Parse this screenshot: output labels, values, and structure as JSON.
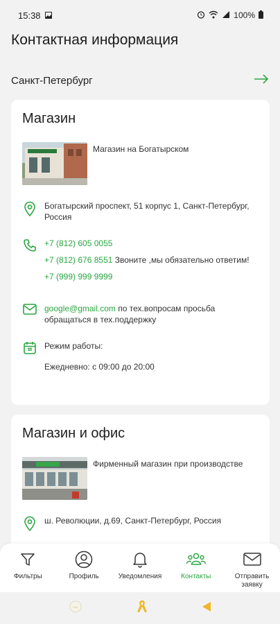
{
  "status_bar": {
    "time": "15:38",
    "battery": "100%"
  },
  "page": {
    "title": "Контактная информация"
  },
  "city": {
    "name": "Санкт-Петербург"
  },
  "stores": [
    {
      "title": "Магазин",
      "description": "Магазин на Богатырском",
      "address": "Богатырский проспект, 51 корпус 1, Санкт-Петербург, Россия",
      "phones": [
        {
          "number": "+7 (812) 605 0055",
          "note": ""
        },
        {
          "number": "+7 (812) 676 8551",
          "note": " Звоните ,мы обязательно ответим!"
        },
        {
          "number": "+7 (999) 999 9999",
          "note": ""
        }
      ],
      "email": "google@gmail.com",
      "email_note": " по тех.вопросам просьба обращаться в тех.поддержку",
      "hours_label": "Режим работы:",
      "hours": "Ежедневно: с 09:00 до 20:00"
    },
    {
      "title": "Магазин и офис",
      "description": "Фирменный магазин при производстве",
      "address": "ш. Революции, д.69, Санкт-Петербург, Россия"
    }
  ],
  "bottom_nav": [
    {
      "label": "Фильтры",
      "icon": "filter-icon"
    },
    {
      "label": "Профиль",
      "icon": "profile-icon"
    },
    {
      "label": "Уведомления",
      "icon": "bell-icon"
    },
    {
      "label": "Контакты",
      "icon": "contacts-icon",
      "active": true
    },
    {
      "label": "Отправить заявку",
      "icon": "mail-icon"
    }
  ],
  "colors": {
    "accent": "#2aa642",
    "background": "#f2f2f2",
    "card": "#ffffff"
  }
}
